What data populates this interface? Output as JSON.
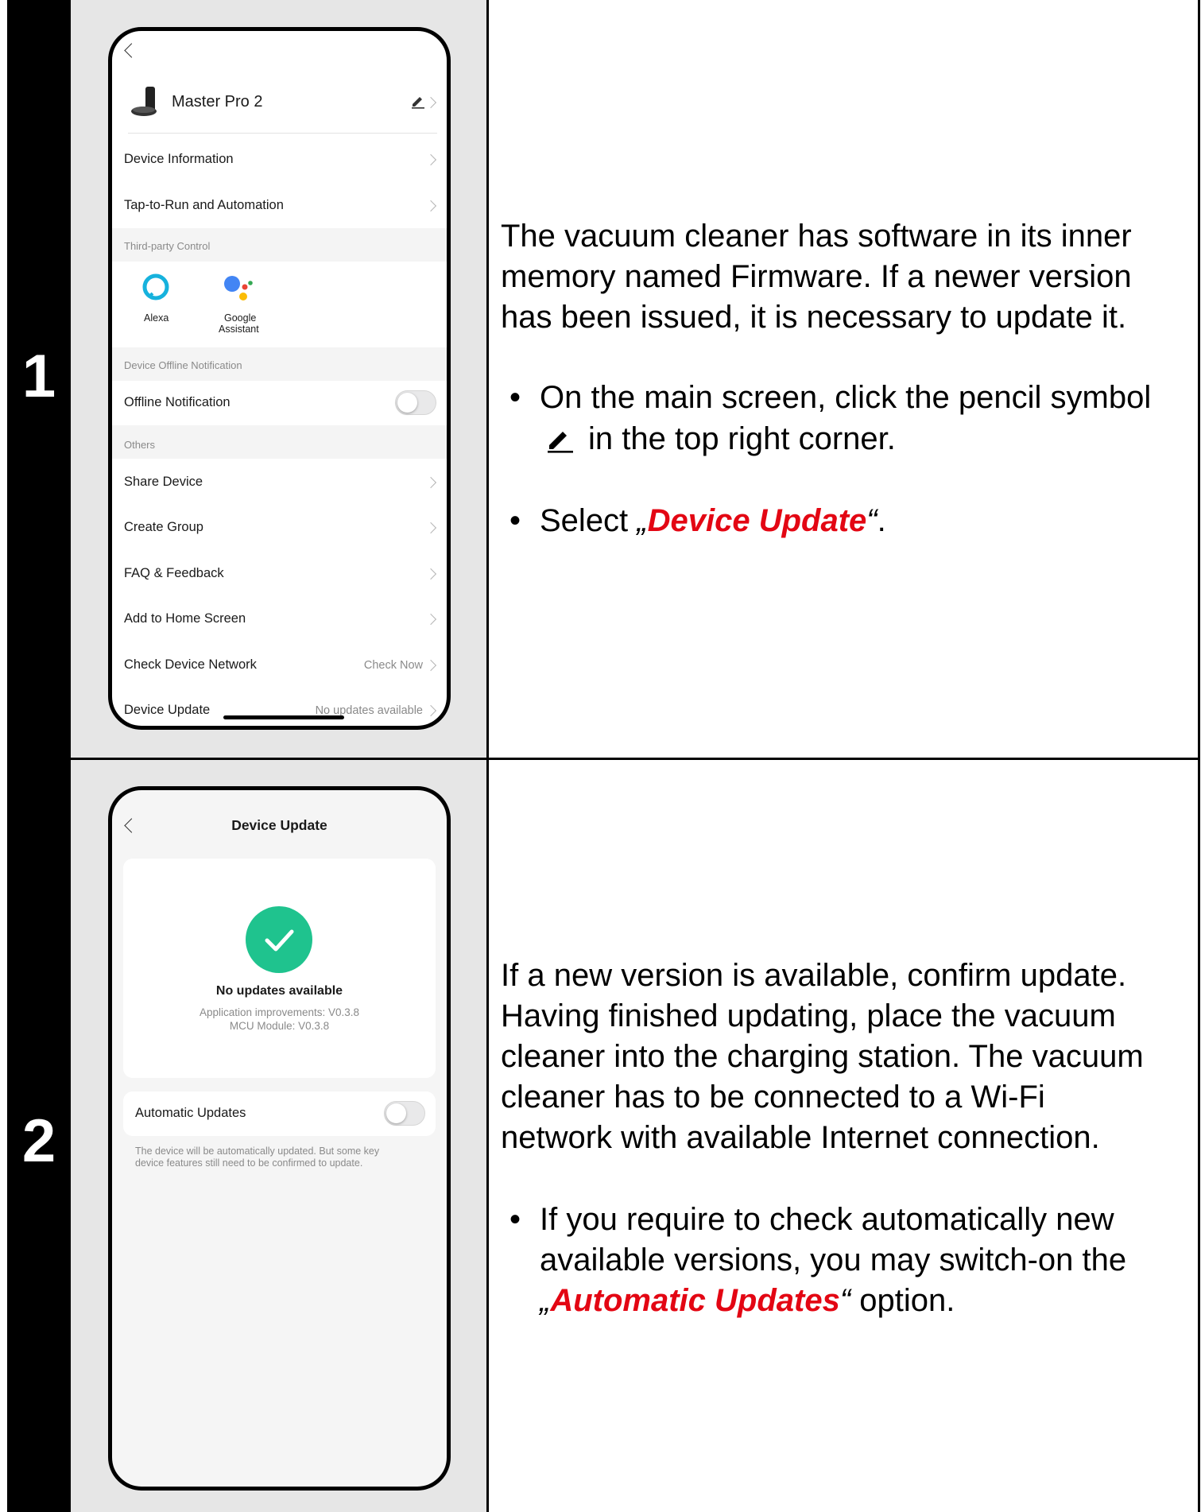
{
  "steps": [
    {
      "number": "1"
    },
    {
      "number": "2"
    }
  ],
  "screen1": {
    "device_name": "Master Pro 2",
    "rows": {
      "device_information": "Device Information",
      "tap_to_run": "Tap-to-Run and Automation",
      "offline_notification": "Offline Notification",
      "share_device": "Share Device",
      "create_group": "Create Group",
      "faq": "FAQ & Feedback",
      "add_home": "Add to Home Screen",
      "check_network": "Check Device Network",
      "check_network_value": "Check Now",
      "device_update": "Device Update",
      "device_update_value": "No updates available"
    },
    "sections": {
      "third_party": "Third-party Control",
      "offline": "Device Offline Notification",
      "others": "Others"
    },
    "third_party": {
      "alexa": "Alexa",
      "google_line1": "Google",
      "google_line2": "Assistant"
    },
    "offline_toggle_on": false
  },
  "screen2": {
    "title": "Device Update",
    "status": "No updates available",
    "app_version": "Application improvements: V0.3.8",
    "mcu_version": "MCU Module: V0.3.8",
    "auto_label": "Automatic Updates",
    "auto_toggle_on": false,
    "note_line1": "The device will be automatically updated. But some key",
    "note_line2": "device features still need to be confirmed to update."
  },
  "instructions1": {
    "line1": "The vacuum cleaner has software in its inner",
    "line2": "memory named Firmware. If a newer version",
    "line3": "has been issued, it is necessary to update it.",
    "bullet1_a": "On the main screen, click the pencil symbol",
    "bullet1_b": "in the top right corner.",
    "bullet2_pre": "Select ",
    "bullet2_open_quote": "„",
    "bullet2_highlight": "Device Update",
    "bullet2_close_quote": "“",
    "bullet2_post": "."
  },
  "instructions2": {
    "line1": "If a new version is available, confirm update.",
    "line2": "Having finished updating, place the vacuum",
    "line3": "cleaner into the charging station. The vacuum",
    "line4": "cleaner has to be connected to a Wi-Fi",
    "line5": "network with available Internet connection.",
    "bullet1_a": "If you require to check automatically new",
    "bullet1_b": "available versions, you may switch-on the",
    "bullet1_open_quote": "„",
    "bullet1_highlight": "Automatic Updates",
    "bullet1_close_quote": "“",
    "bullet1_post": " option."
  },
  "colors": {
    "highlight": "#e30613",
    "success": "#1fc38e",
    "google_blue": "#4285f4",
    "google_red": "#ea4335",
    "google_yellow": "#fbbc05",
    "google_green": "#34a853",
    "alexa": "#16b2dd"
  }
}
